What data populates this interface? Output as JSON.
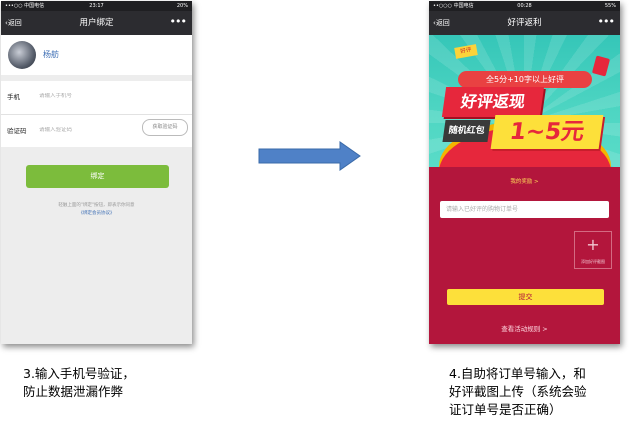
{
  "phone1": {
    "status": {
      "carrier": "•••○○ 中国电信",
      "time": "23:17",
      "battery": "20%"
    },
    "nav": {
      "back_label": "返回",
      "title": "用户绑定",
      "more": "•••"
    },
    "profile": {
      "name": "杨舫"
    },
    "form": {
      "phone_label": "手机",
      "phone_placeholder": "请输入手机号",
      "code_label": "验证码",
      "code_placeholder": "请输入验证码",
      "get_code_label": "获取验证码"
    },
    "bind_button": "绑定",
    "agreement_note": "轻触上面的\"绑定\"按钮，即表示你同意",
    "agreement_link": "《绑定会员协议》"
  },
  "phone2": {
    "status": {
      "carrier": "••○○○ 中国电信",
      "time": "00:28",
      "battery": "55%"
    },
    "nav": {
      "back_label": "返回",
      "title": "好评返利",
      "more": "•••"
    },
    "banner": {
      "tag": "好评",
      "line1": "全5分+10字以上好评",
      "line2": "好评返现",
      "line3": "随机红包",
      "line4": "1~5元"
    },
    "my_reward": "我的奖励 >",
    "order_placeholder": "请输入已好评的购物订单号",
    "upload_label": "添加好评截图",
    "submit_label": "提交",
    "rules_link": "查看活动规则 >"
  },
  "captions": {
    "step3": "3.输入手机号验证，\n防止数据泄漏作弊",
    "step4": "4.自助将订单号输入，和\n好评截图上传（系统会验\n证订单号是否正确）"
  },
  "colors": {
    "nav_bg": "#2c2c30",
    "bind_green": "#7cbc3c",
    "arrow_blue": "#4f81c7",
    "promo_red": "#b3163c",
    "submit_yellow": "#fde03a"
  },
  "icons": [
    "back-chevron-icon",
    "more-dots-icon",
    "right-arrow-icon",
    "plus-icon"
  ]
}
